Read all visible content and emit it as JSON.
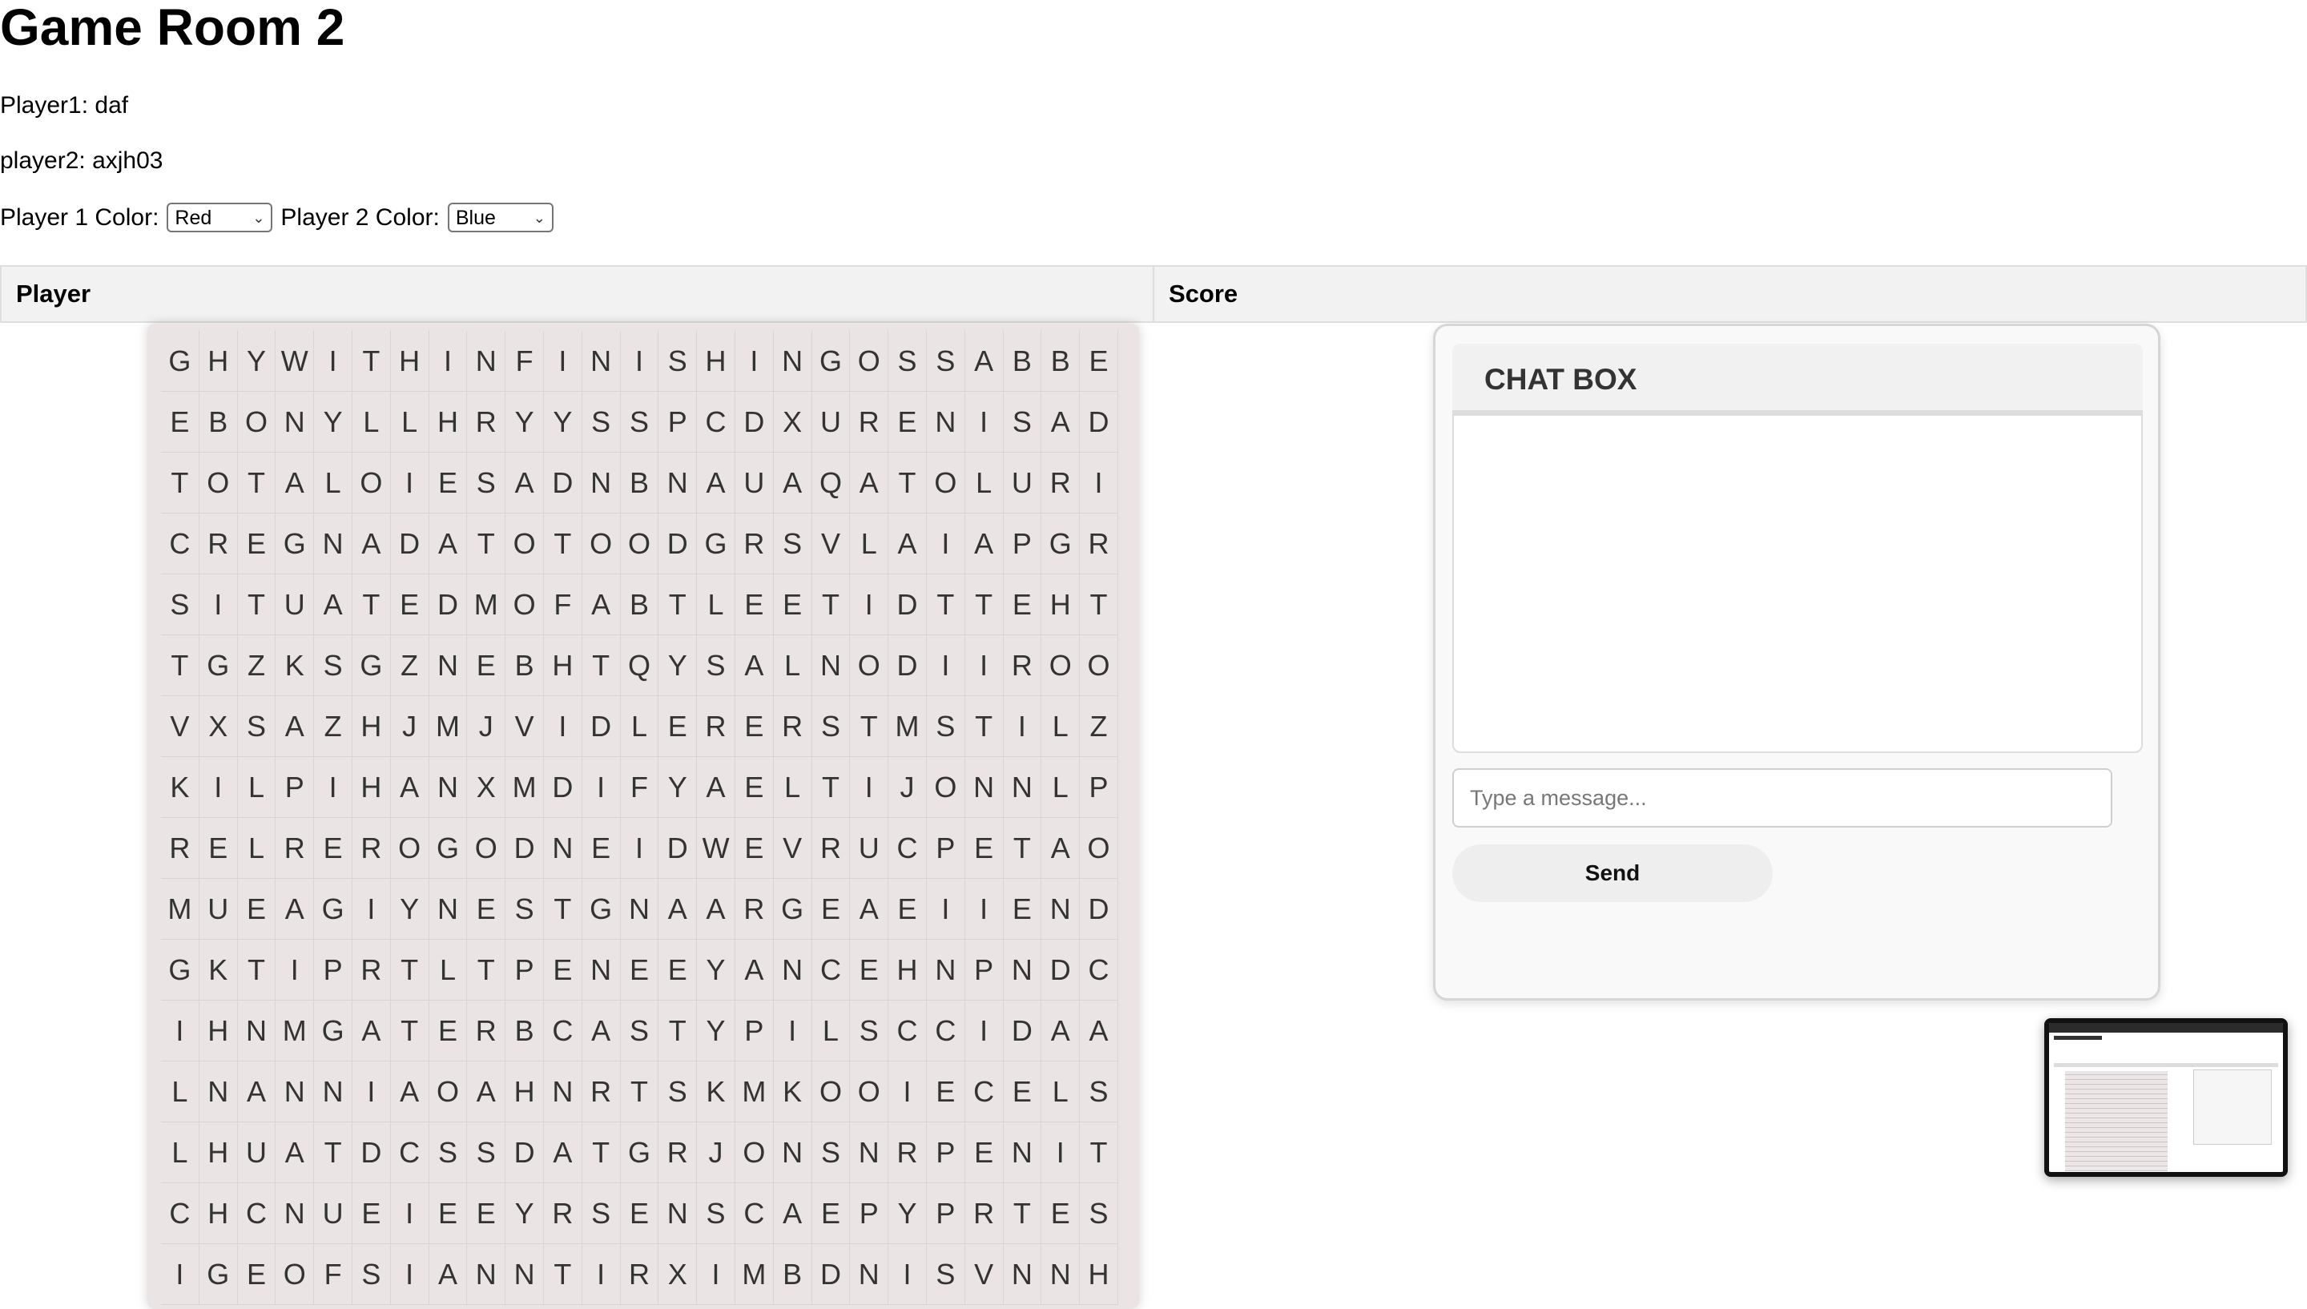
{
  "page": {
    "title": "Game Room 2"
  },
  "players": {
    "player1_label": "Player1: daf",
    "player2_label": "player2: axjh03"
  },
  "colors": {
    "p1_label": "Player 1 Color:",
    "p1_value": "Red",
    "p2_label": "Player 2 Color:",
    "p2_value": "Blue"
  },
  "score_table": {
    "headers": [
      "Player",
      "Score"
    ]
  },
  "grid": {
    "rows": [
      "GHYWITHINFINISHINGOSSABBE",
      "EBONYLLHRYYSSPCDXURENISAD",
      "TOTALOIESADNBNAUAQATOLURI",
      "CREGNADATOTOODGRSVLAIAPGR",
      "SITUATEDMOFABTLEETIDTTEHT",
      "TGZKSGZNEBHTQYSALNODIIROO",
      "VXSAZHJMJVIDLERERSTMSTILZ",
      "KILPIHANXMDIFYAELTIJONNLP",
      "RELREROGODNEIDWEVRUCPETAO",
      "MUEAGIYNESTGNAARGEAEIIEND",
      "GKTIPRTLTPENEEYANCEHNPNDC",
      "IHNMGATERBCASTYPILSCCIDAA",
      "LNANNIAOAHNRTSKMKOOIECELS",
      "LHUATDCSSDATGRJONSNRPENIT",
      "CHCNUEIEEYRSENSCAEPYPRTES",
      "IGEOFSIANNTIRXIMBDNISVNNH"
    ]
  },
  "chat": {
    "title": "CHAT BOX",
    "input_placeholder": "Type a message...",
    "send_label": "Send"
  }
}
